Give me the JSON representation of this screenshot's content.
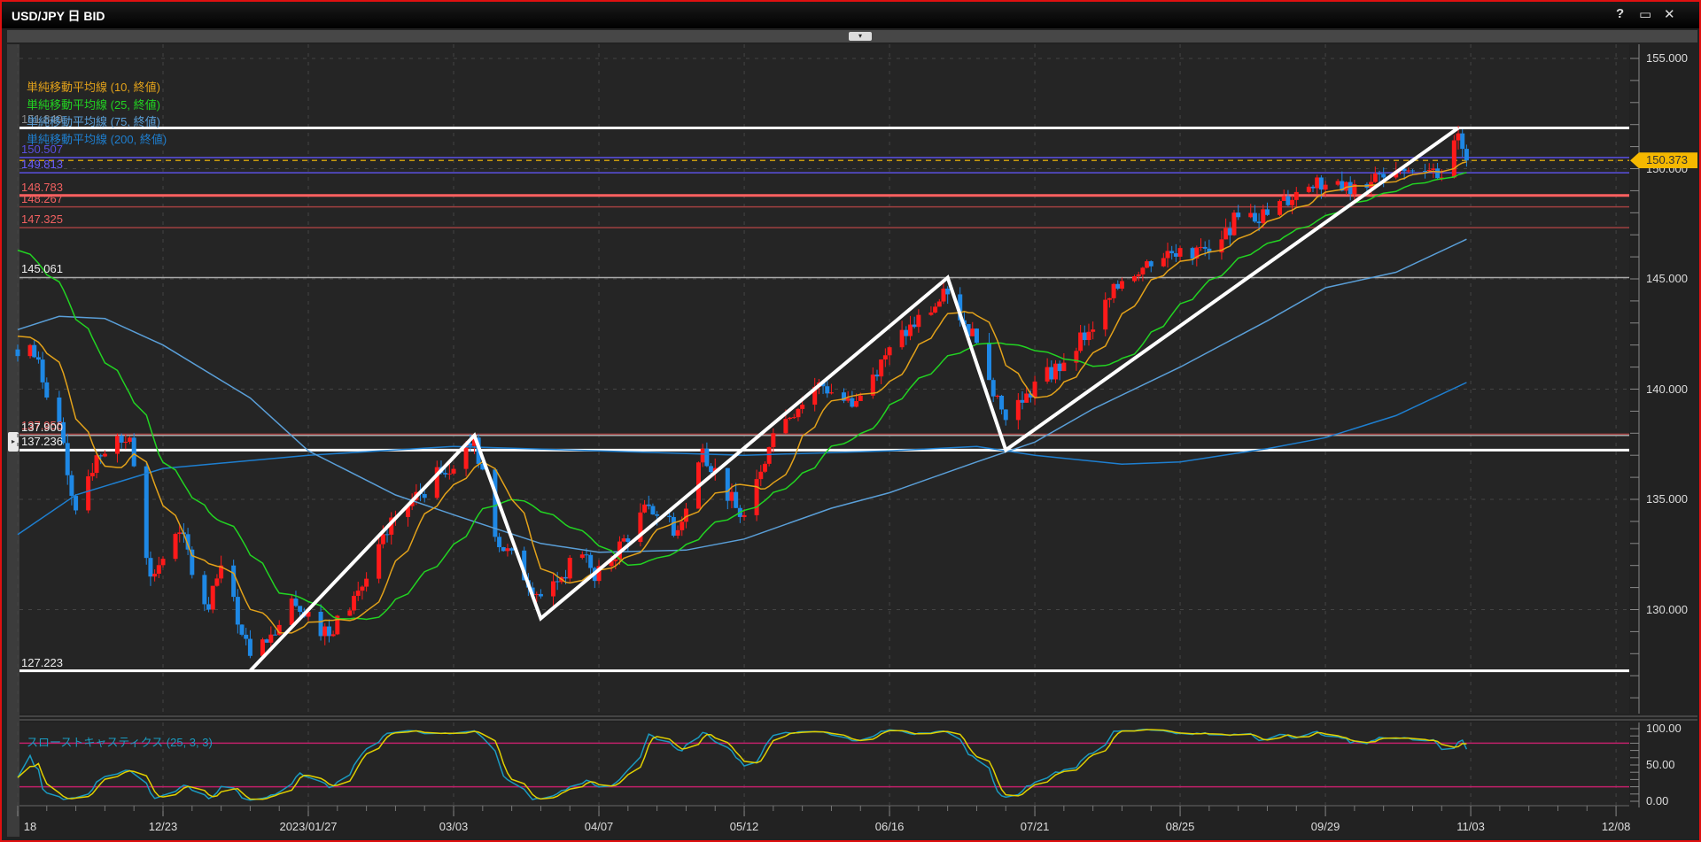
{
  "window": {
    "title": "USD/JPY 日 BID",
    "help_icon": "?",
    "restore_icon": "▭",
    "close_icon": "✕",
    "collapse_icon": "▾",
    "panel_arrow_icon": "▸"
  },
  "legend": [
    {
      "label": "単純移動平均線 (10, 終値)",
      "color": "#e3a21a"
    },
    {
      "label": "単純移動平均線 (25, 終値)",
      "color": "#22d422"
    },
    {
      "label": "単純移動平均線 (75, 終値)",
      "color": "#5a9fd8"
    },
    {
      "label": "単純移動平均線 (200, 終値)",
      "color": "#1e7fd0"
    }
  ],
  "levels": [
    {
      "label": "151.849",
      "price": 151.849,
      "color": "#ffffff",
      "labelColor": "#888",
      "thick": true
    },
    {
      "label": "150.507",
      "price": 150.507,
      "color": "#5a4fe0",
      "labelColor": "#5a4fe0",
      "thick": false
    },
    {
      "label": "149.813",
      "price": 149.813,
      "color": "#5a4fe0",
      "labelColor": "#6a5cff",
      "thick": false
    },
    {
      "label": "148.783",
      "price": 148.783,
      "color": "#ff6060",
      "labelColor": "#f06060",
      "thick": true
    },
    {
      "label": "148.267",
      "price": 148.267,
      "color": "#a04040",
      "labelColor": "#f06060",
      "thick": false
    },
    {
      "label": "147.325",
      "price": 147.325,
      "color": "#a04040",
      "labelColor": "#f06060",
      "thick": false
    },
    {
      "label": "145.061",
      "price": 145.061,
      "color": "#aaaaaa",
      "labelColor": "#eeeeee",
      "thick": false
    },
    {
      "label": "137.956",
      "price": 137.956,
      "color": "#a04040",
      "labelColor": "#f06060",
      "thick": false
    },
    {
      "label": "137.900",
      "price": 137.9,
      "color": "#aaaaaa",
      "labelColor": "#eeeeee",
      "thick": false
    },
    {
      "label": "137.236",
      "price": 137.236,
      "color": "#ffffff",
      "labelColor": "#eeeeee",
      "thick": true
    },
    {
      "label": "127.223",
      "price": 127.223,
      "color": "#ffffff",
      "labelColor": "#eeeeee",
      "thick": true
    }
  ],
  "current_price": {
    "label": "150.373",
    "price": 150.373,
    "color": "#f5b800"
  },
  "price_axis": {
    "labels": [
      "155.000",
      "150.000",
      "145.000",
      "140.000",
      "135.000",
      "130.000"
    ],
    "values": [
      155,
      150,
      145,
      140,
      135,
      130
    ]
  },
  "date_axis": {
    "labels": [
      "18",
      "12/23",
      "2023/01/27",
      "03/03",
      "04/07",
      "05/12",
      "06/16",
      "07/21",
      "08/25",
      "09/29",
      "11/03",
      "12/08"
    ],
    "dates": [
      "2022-11-18",
      "2022-12-23",
      "2023-01-27",
      "2023-03-03",
      "2023-04-07",
      "2023-05-12",
      "2023-06-16",
      "2023-07-21",
      "2023-08-25",
      "2023-09-29",
      "2023-11-03",
      "2023-12-08"
    ]
  },
  "stochastic": {
    "label": "スローストキャスティクス (25, 3, 3)",
    "axis_labels": [
      "100.00",
      "50.00",
      "0.00"
    ],
    "axis_values": [
      100,
      50,
      0
    ],
    "bands": [
      80,
      20
    ],
    "k_color": "#1a9ac0",
    "d_color": "#e0d000",
    "band_color": "#c0206a"
  },
  "chart_data": {
    "type": "candlestick",
    "symbol": "USD/JPY",
    "timeframe": "日",
    "side": "BID",
    "up_color": "#ff1a1a",
    "down_color": "#1e88e5",
    "close_pivots": [
      [
        "2022-11-18",
        141.5
      ],
      [
        "2022-11-21",
        142.0
      ],
      [
        "2022-11-28",
        138.5
      ],
      [
        "2022-12-02",
        134.5
      ],
      [
        "2022-12-07",
        137.0
      ],
      [
        "2022-12-15",
        137.8
      ],
      [
        "2022-12-16",
        136.5
      ],
      [
        "2022-12-20",
        131.5
      ],
      [
        "2022-12-27",
        133.5
      ],
      [
        "2023-01-03",
        130.0
      ],
      [
        "2023-01-06",
        132.0
      ],
      [
        "2023-01-13",
        127.9
      ],
      [
        "2023-01-17",
        128.5
      ],
      [
        "2023-01-23",
        130.5
      ],
      [
        "2023-01-27",
        129.9
      ],
      [
        "2023-02-01",
        128.8
      ],
      [
        "2023-02-10",
        131.4
      ],
      [
        "2023-02-17",
        134.2
      ],
      [
        "2023-02-28",
        136.2
      ],
      [
        "2023-03-08",
        137.8
      ],
      [
        "2023-03-13",
        133.3
      ],
      [
        "2023-03-24",
        130.6
      ],
      [
        "2023-04-03",
        132.5
      ],
      [
        "2023-04-06",
        131.3
      ],
      [
        "2023-04-19",
        134.7
      ],
      [
        "2023-04-26",
        133.6
      ],
      [
        "2023-05-02",
        137.3
      ],
      [
        "2023-05-11",
        134.2
      ],
      [
        "2023-05-19",
        138.0
      ],
      [
        "2023-05-30",
        140.3
      ],
      [
        "2023-06-07",
        139.2
      ],
      [
        "2023-06-16",
        141.9
      ],
      [
        "2023-06-30",
        144.3
      ],
      [
        "2023-07-07",
        142.1
      ],
      [
        "2023-07-14",
        138.6
      ],
      [
        "2023-07-19",
        139.8
      ],
      [
        "2023-07-28",
        141.2
      ],
      [
        "2023-08-03",
        142.6
      ],
      [
        "2023-08-11",
        144.9
      ],
      [
        "2023-08-17",
        145.8
      ],
      [
        "2023-08-25",
        146.4
      ],
      [
        "2023-09-01",
        146.2
      ],
      [
        "2023-09-08",
        147.8
      ],
      [
        "2023-09-15",
        147.9
      ],
      [
        "2023-09-27",
        149.6
      ],
      [
        "2023-10-03",
        149.0
      ],
      [
        "2023-10-06",
        149.3
      ],
      [
        "2023-10-13",
        149.6
      ],
      [
        "2023-10-20",
        149.9
      ],
      [
        "2023-10-27",
        149.6
      ],
      [
        "2023-10-31",
        151.6
      ],
      [
        "2023-11-01",
        150.9
      ],
      [
        "2023-11-02",
        150.373
      ]
    ],
    "ma75": [
      [
        "2022-11-18",
        142.7
      ],
      [
        "2022-11-28",
        143.3
      ],
      [
        "2022-12-09",
        143.2
      ],
      [
        "2022-12-23",
        142.0
      ],
      [
        "2023-01-13",
        139.6
      ],
      [
        "2023-01-27",
        137.2
      ],
      [
        "2023-02-17",
        135.2
      ],
      [
        "2023-03-03",
        134.3
      ],
      [
        "2023-03-24",
        133.0
      ],
      [
        "2023-04-07",
        132.6
      ],
      [
        "2023-04-28",
        132.7
      ],
      [
        "2023-05-12",
        133.2
      ],
      [
        "2023-06-02",
        134.6
      ],
      [
        "2023-06-16",
        135.3
      ],
      [
        "2023-07-07",
        136.7
      ],
      [
        "2023-07-21",
        137.6
      ],
      [
        "2023-08-04",
        139.1
      ],
      [
        "2023-08-25",
        141.0
      ],
      [
        "2023-09-15",
        143.1
      ],
      [
        "2023-09-29",
        144.6
      ],
      [
        "2023-10-16",
        145.3
      ],
      [
        "2023-11-02",
        146.8
      ]
    ],
    "ma200": [
      [
        "2022-11-18",
        133.4
      ],
      [
        "2022-12-02",
        135.2
      ],
      [
        "2022-12-23",
        136.4
      ],
      [
        "2023-01-27",
        137.0
      ],
      [
        "2023-03-03",
        137.4
      ],
      [
        "2023-04-07",
        137.2
      ],
      [
        "2023-05-12",
        137.0
      ],
      [
        "2023-06-16",
        137.2
      ],
      [
        "2023-07-07",
        137.4
      ],
      [
        "2023-07-21",
        137.0
      ],
      [
        "2023-08-11",
        136.6
      ],
      [
        "2023-08-25",
        136.7
      ],
      [
        "2023-09-15",
        137.3
      ],
      [
        "2023-09-29",
        137.8
      ],
      [
        "2023-10-16",
        138.8
      ],
      [
        "2023-11-02",
        140.3
      ]
    ],
    "zigzag": [
      [
        "2023-01-13",
        127.223
      ],
      [
        "2023-03-08",
        137.9
      ],
      [
        "2023-03-24",
        129.6
      ],
      [
        "2023-06-30",
        145.061
      ],
      [
        "2023-07-14",
        137.236
      ],
      [
        "2023-10-31",
        151.849
      ]
    ],
    "ylim": [
      125,
      156
    ]
  }
}
